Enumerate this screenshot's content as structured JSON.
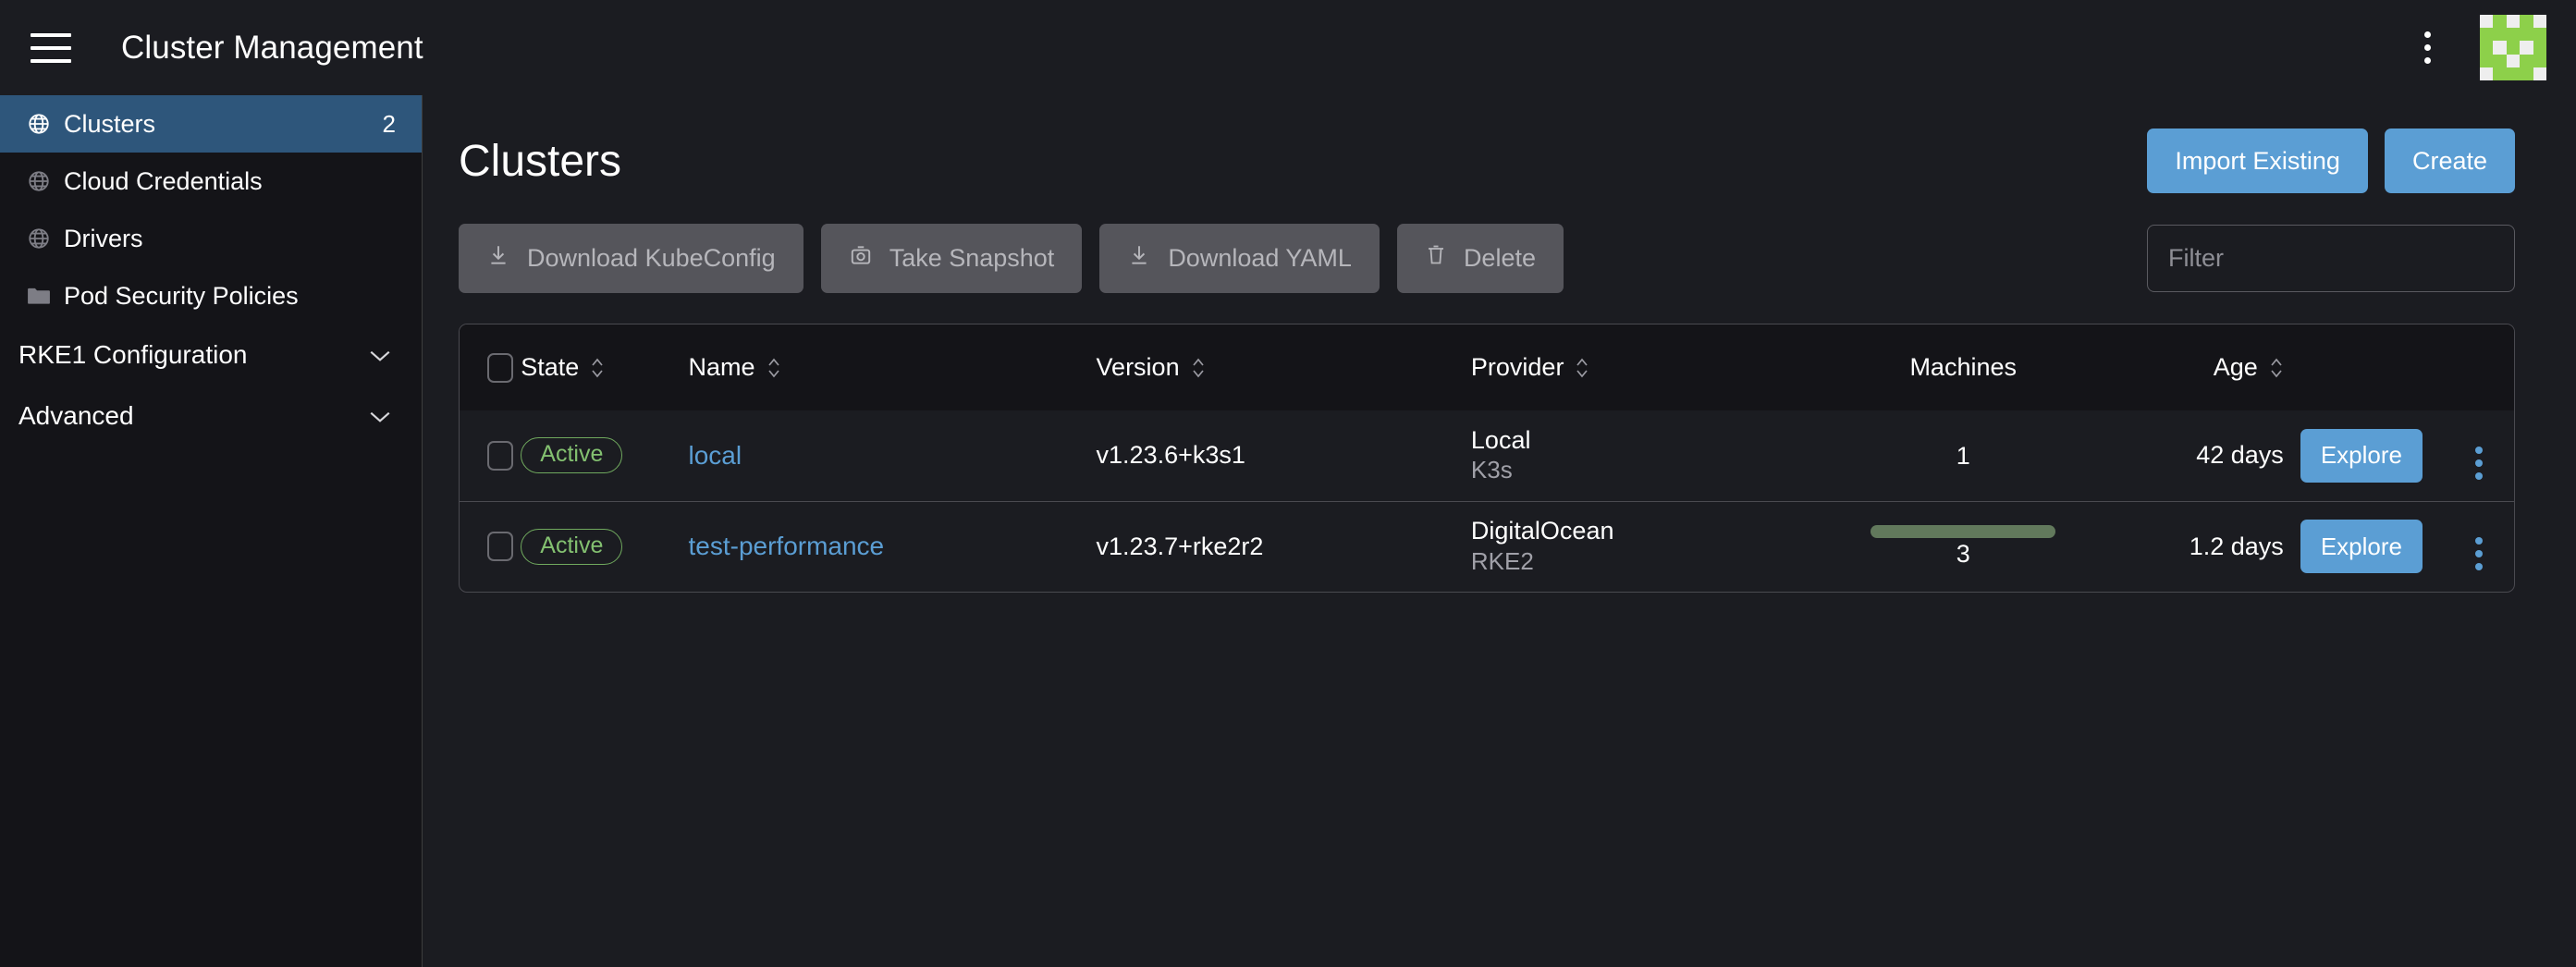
{
  "topbar": {
    "menu_icon": "hamburger-icon",
    "title": "Cluster Management",
    "overflow_icon": "kebab-menu-icon",
    "avatar_icon": "user-avatar-identicon",
    "avatar_color": "#8dd04a"
  },
  "sidebar": {
    "items": [
      {
        "label": "Clusters",
        "icon": "globe-icon",
        "count": "2",
        "active": true
      },
      {
        "label": "Cloud Credentials",
        "icon": "globe-icon",
        "count": "",
        "active": false
      },
      {
        "label": "Drivers",
        "icon": "globe-icon",
        "count": "",
        "active": false
      },
      {
        "label": "Pod Security Policies",
        "icon": "folder-icon",
        "count": "",
        "active": false
      }
    ],
    "groups": [
      {
        "label": "RKE1 Configuration",
        "icon": "chevron-down-icon"
      },
      {
        "label": "Advanced",
        "icon": "chevron-down-icon"
      }
    ]
  },
  "main": {
    "page_title": "Clusters",
    "import_label": "Import Existing",
    "create_label": "Create",
    "toolbar": [
      {
        "label": "Download KubeConfig",
        "icon": "download-icon"
      },
      {
        "label": "Take Snapshot",
        "icon": "camera-icon"
      },
      {
        "label": "Download YAML",
        "icon": "download-icon"
      },
      {
        "label": "Delete",
        "icon": "trash-icon"
      }
    ],
    "filter_placeholder": "Filter",
    "filter_value": ""
  },
  "table": {
    "columns": [
      {
        "label": "State",
        "sortable": true
      },
      {
        "label": "Name",
        "sortable": true
      },
      {
        "label": "Version",
        "sortable": true
      },
      {
        "label": "Provider",
        "sortable": true
      },
      {
        "label": "Machines",
        "sortable": false
      },
      {
        "label": "Age",
        "sortable": true
      }
    ],
    "rows": [
      {
        "state": "Active",
        "name": "local",
        "version": "v1.23.6+k3s1",
        "provider": "Local",
        "provider_sub": "K3s",
        "machines": "1",
        "machines_bar": false,
        "age": "42 days",
        "explore_label": "Explore"
      },
      {
        "state": "Active",
        "name": "test-performance",
        "version": "v1.23.7+rke2r2",
        "provider": "DigitalOcean",
        "provider_sub": "RKE2",
        "machines": "3",
        "machines_bar": true,
        "age": "1.2 days",
        "explore_label": "Explore"
      }
    ]
  },
  "colors": {
    "accent_blue": "#5b9ed4",
    "active_green": "#83c070",
    "sidebar_active": "#2e567b",
    "bar_green": "#62795c"
  }
}
